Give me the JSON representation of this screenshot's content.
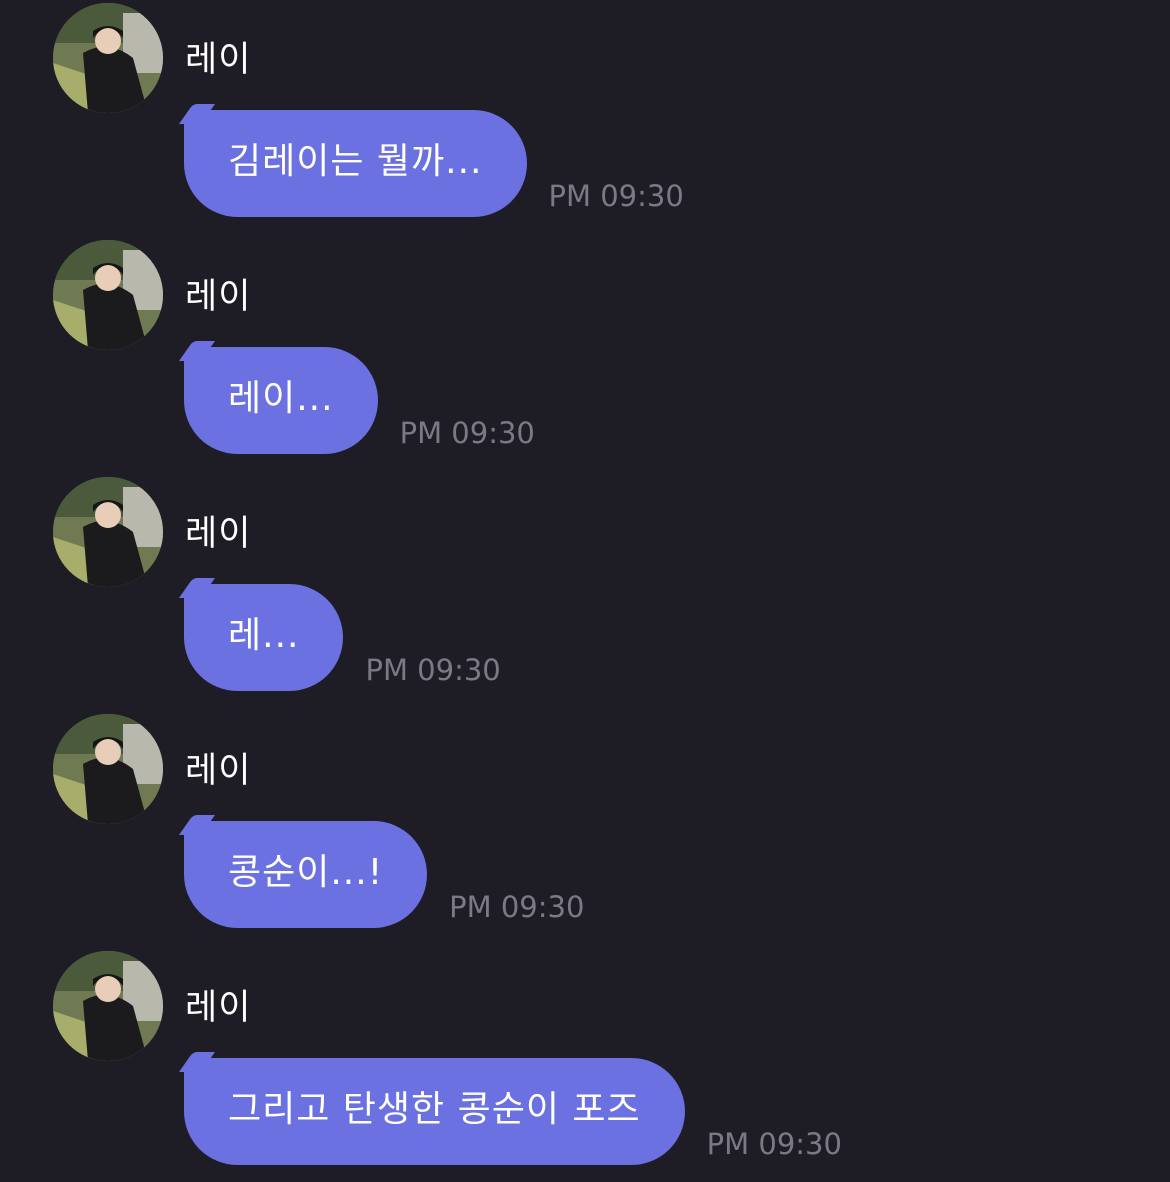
{
  "messages": [
    {
      "sender": "레이",
      "text": "김레이는 뭘까...",
      "time": "PM 09:30"
    },
    {
      "sender": "레이",
      "text": "레이...",
      "time": "PM 09:30"
    },
    {
      "sender": "레이",
      "text": "레...",
      "time": "PM 09:30"
    },
    {
      "sender": "레이",
      "text": "콩순이...!",
      "time": "PM 09:30"
    },
    {
      "sender": "레이",
      "text": "그리고 탄생한 콩순이 포즈",
      "time": "PM 09:30"
    }
  ],
  "colors": {
    "background": "#1e1d26",
    "bubble": "#6b71e0",
    "bubble_text": "#ffffff",
    "sender_text": "#ffffff",
    "time_text": "#7a7985"
  },
  "icons": {
    "avatar": "profile-photo"
  }
}
